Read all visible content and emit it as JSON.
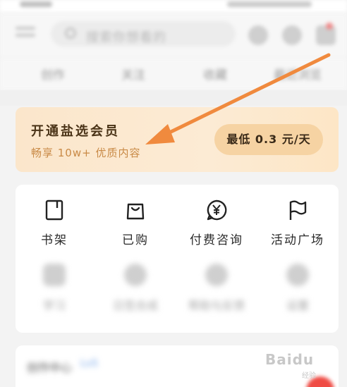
{
  "header": {
    "search_placeholder": "搜索你想看的"
  },
  "tabs": [
    "创作",
    "关注",
    "收藏",
    "最近浏览"
  ],
  "vip": {
    "title": "开通盐选会员",
    "subtitle": "畅享 10w+ 优质内容",
    "price_button": "最低 0.3 元/天"
  },
  "grid": {
    "row1": [
      {
        "label": "书架",
        "icon": "bookshelf-icon"
      },
      {
        "label": "已购",
        "icon": "shopping-bag-icon"
      },
      {
        "label": "付费咨询",
        "icon": "yuan-chat-icon"
      },
      {
        "label": "活动广场",
        "icon": "flag-icon"
      }
    ],
    "row2": [
      {
        "label": "学习"
      },
      {
        "label": "日签合成"
      },
      {
        "label": "帮助与反馈"
      },
      {
        "label": "设置"
      }
    ]
  },
  "bottom": {
    "title": "创作中心",
    "tag": "Lv5"
  },
  "watermark": {
    "brand": "Baidu",
    "sub": "经验"
  },
  "colors": {
    "vip_bg": "#fbe6cb",
    "vip_button": "#f6d3a3",
    "vip_subtitle": "#c98a46",
    "arrow": "#f08a3e"
  }
}
